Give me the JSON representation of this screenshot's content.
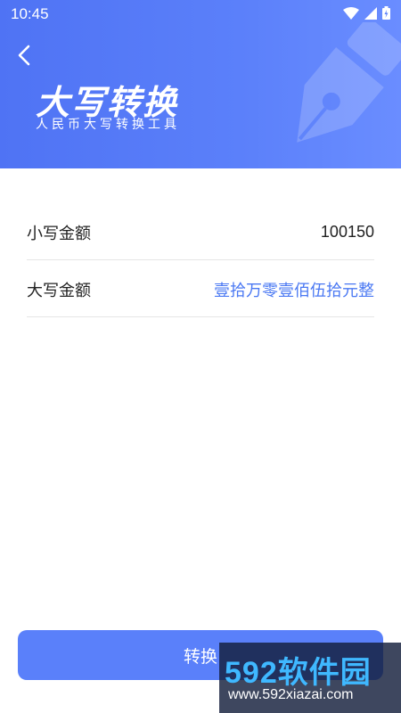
{
  "status_bar": {
    "time": "10:45",
    "icons": [
      "wifi-icon",
      "signal-icon",
      "battery-icon"
    ]
  },
  "header": {
    "title": "大写转换",
    "subtitle": "人民币大写转换工具",
    "back_icon": "chevron-left-icon",
    "decoration_icon": "fountain-pen-icon"
  },
  "form": {
    "lowercase_label": "小写金额",
    "lowercase_value": "100150",
    "uppercase_label": "大写金额",
    "uppercase_value": "壹拾万零壹佰伍拾元整"
  },
  "actions": {
    "convert_label": "转换"
  },
  "watermark": {
    "text": "592软件园",
    "url": "www.592xiazai.com"
  },
  "colors": {
    "header_start": "#4f73f4",
    "header_end": "#6a8dff",
    "button": "#5a80fa",
    "result_text": "#4a78f3"
  }
}
